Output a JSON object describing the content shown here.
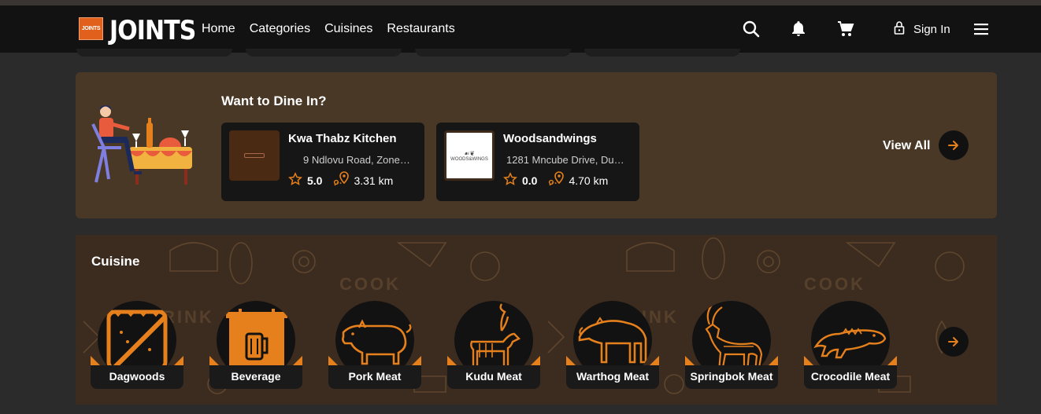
{
  "header": {
    "logo_small_text": "JOINTS",
    "logo_text": "JOINTS",
    "nav": [
      "Home",
      "Categories",
      "Cuisines",
      "Restaurants"
    ],
    "icons": [
      "search-icon",
      "bell-icon",
      "cart-icon",
      "lock-icon",
      "menu-icon"
    ],
    "sign_in": "Sign In"
  },
  "dine_in": {
    "title": "Want to Dine In?",
    "restaurants": [
      {
        "name": "Kwa Thabz Kitchen",
        "address": "9 Ndlovu Road, Zone…",
        "rating": "5.0",
        "distance": "3.31 km",
        "thumb_color": "#4a2a12"
      },
      {
        "name": "Woodsandwings",
        "address": "1281 Mncube Drive, Du…",
        "rating": "0.0",
        "distance": "4.70 km",
        "thumb_color": "#ffffff",
        "thumb_text": "WOODS&WINGS"
      }
    ],
    "view_all": "View All"
  },
  "cuisine": {
    "title": "Cuisine",
    "items": [
      "Dagwoods",
      "Beverage",
      "Pork Meat",
      "Kudu Meat",
      "Warthog Meat",
      "Springbok Meat",
      "Crocodile Meat"
    ]
  },
  "colors": {
    "accent": "#e5801c",
    "nav_bg": "#121212",
    "dine_bg": "#4a3826",
    "cuisine_bg": "#3c2c1f"
  }
}
